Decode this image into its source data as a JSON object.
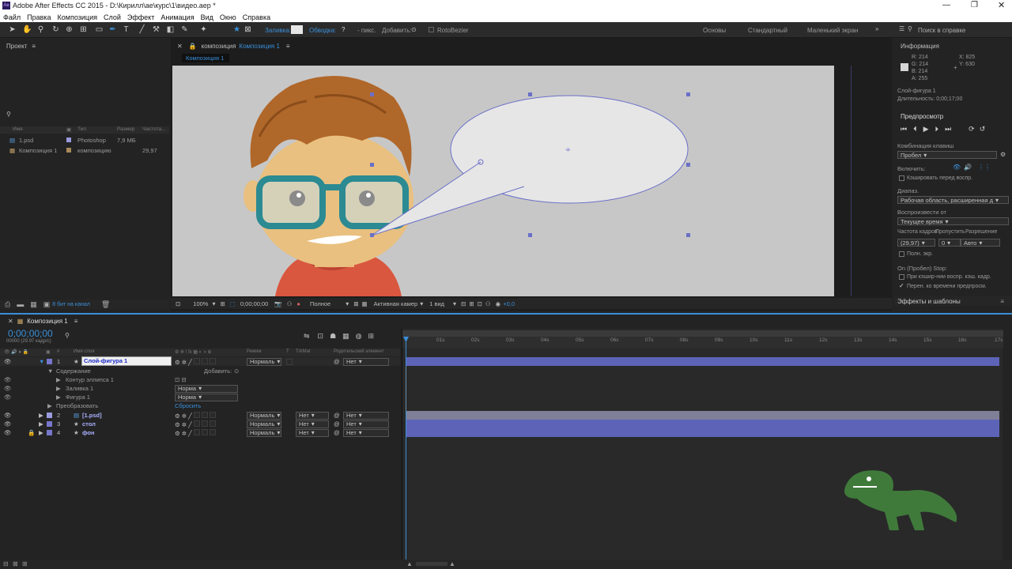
{
  "window": {
    "title": "Adobe After Effects CC 2015 - D:\\Кирилл\\ае\\курс\\1\\видео.aep *"
  },
  "menu": [
    "Файл",
    "Правка",
    "Композиция",
    "Слой",
    "Эффект",
    "Анимация",
    "Вид",
    "Окно",
    "Справка"
  ],
  "toolbar": {
    "fill_label": "Заливка:",
    "stroke_label": "Обводка:",
    "stroke_value": "?",
    "px_label": "- пикс.",
    "add_label": "Добавить:",
    "rotobezier": "RotoBezier",
    "workspaces": [
      "Основы",
      "Стандартный",
      "Маленький экран"
    ],
    "search_placeholder": "Поиск в справке"
  },
  "project": {
    "title": "Проект",
    "columns": [
      "Имя",
      "Тип",
      "Размер",
      "Частота..."
    ],
    "items": [
      {
        "name": "1.psd",
        "type": "Photoshop",
        "size": "7,9 МБ",
        "rate": ""
      },
      {
        "name": "Композиция 1",
        "type": "композицию",
        "size": "",
        "rate": "29,97"
      }
    ],
    "bpc": "8 бит на канал"
  },
  "comp": {
    "tab_prefix": "композиция",
    "tab_name": "Композиция 1",
    "sub_tab": "Композиция 1",
    "zoom": "100%",
    "time": "0;00;00;00",
    "resolution": "Полное",
    "camera": "Активная камер",
    "views": "1 вид",
    "exposure": "+0,0"
  },
  "info": {
    "title": "Информация",
    "r": "R: 214",
    "g": "G: 214",
    "b": "B: 214",
    "a": "A: 255",
    "x": "X: 825",
    "y": "Y: 630",
    "layer": "Слой-фигура 1",
    "duration": "Длительность: 0;00;17;00"
  },
  "preview": {
    "title": "Предпросмотр",
    "shortcut_label": "Комбинация клавиш",
    "shortcut": "Пробел",
    "include_label": "Включить:",
    "cache_label": "Кэшировать перед воспр.",
    "range_label": "Диапаз.",
    "range": "Рабочая область, расширенная д",
    "play_from_label": "Воспроизвести от",
    "play_from": "Текущее время",
    "framerate_label": "Частота кадров",
    "skip_label": "Пропустить",
    "resolution_label": "Разрешение",
    "framerate": "(29,97)",
    "skip": "0",
    "resolution": "Авто",
    "fullscreen": "Полн. экр.",
    "stop_label": "On (Пробел) Stop:",
    "stop_opt1": "При кэшир-нии воспр. кэш. кадр.",
    "stop_opt2": "Перен. ко времени предпросм.",
    "effects": "Эффекты и шаблоны"
  },
  "timeline": {
    "tab": "Композиция 1",
    "timecode": "0;00;00;00",
    "fps": "00000 (29.97 кадр/с)",
    "col_name": "Имя слоя",
    "col_mode": "Режим",
    "col_t": "T",
    "col_trkmat": "TrkMat",
    "col_parent": "Родительский элемент",
    "ruler": [
      "01s",
      "02s",
      "03s",
      "04s",
      "05s",
      "06s",
      "07s",
      "08s",
      "09s",
      "10s",
      "11s",
      "12s",
      "13s",
      "14s",
      "15s",
      "16s",
      "17s"
    ],
    "layers": [
      {
        "num": "1",
        "name": "Слой-фигура 1",
        "mode": "Нормаль",
        "trkmat": "",
        "parent": "Нет"
      },
      {
        "num": "2",
        "name": "[1.psd]",
        "mode": "Нормаль",
        "trkmat": "Нет",
        "parent": "Нет"
      },
      {
        "num": "3",
        "name": "стол",
        "mode": "Нормаль",
        "trkmat": "Нет",
        "parent": "Нет"
      },
      {
        "num": "4",
        "name": "фон",
        "mode": "Нормаль",
        "trkmat": "Нет",
        "parent": "Нет"
      }
    ],
    "contents_label": "Содержание",
    "add_label": "Добавить:",
    "ellipse_path": "Контур эллипса 1",
    "fill": "Заливка 1",
    "fill_mode": "Норма",
    "shape": "Фигура 1",
    "shape_mode": "Норма",
    "transform": "Преобразовать",
    "reset": "Сбросить"
  },
  "colors": {
    "accent": "#3a8fd8",
    "track": "#6a70a8",
    "playhead": "#3a8fd8"
  }
}
